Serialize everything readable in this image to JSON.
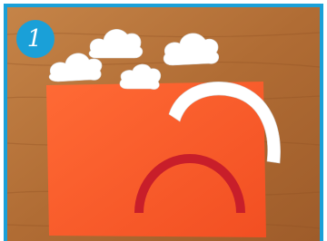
{
  "step": {
    "number": "1"
  },
  "colors": {
    "frame": "#1aa0d8",
    "table": "#b5723a",
    "paper": "#fa5a2a",
    "rainbow_red": "#c81e2a",
    "cloud_white": "#ffffff"
  },
  "icons": [
    "cloud-cutout",
    "white-arc-cutout",
    "red-arc-cutout"
  ]
}
